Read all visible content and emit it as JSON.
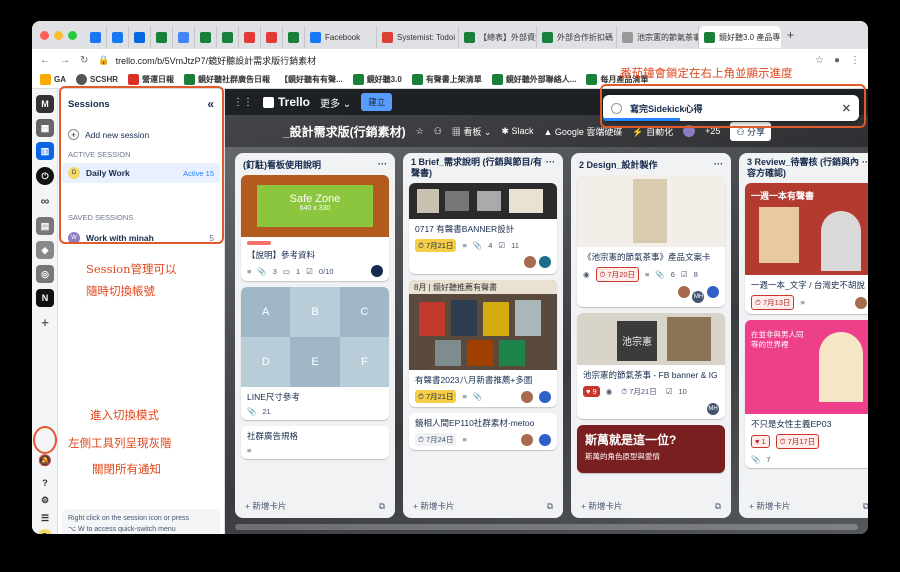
{
  "tabs": [
    "",
    "",
    "",
    "",
    "",
    "",
    "",
    "",
    "",
    "",
    "Facebook",
    "Systemist: Todoi",
    "【總表】外部資源",
    "外部合作折扣碼",
    "池宗憲的節氣茶事",
    "鏡好聽3.0 產品專"
  ],
  "address": {
    "url": "trello.com/b/5VmJtzP7/鏡好聽設計需求版行銷素材"
  },
  "bookmarks": [
    "GA",
    "SCSHR",
    "營運日報",
    "鏡好聽社群廣告日報",
    "【鏡好聽有有聲...",
    "鏡好聽3.0",
    "有聲書上架清單",
    "鏡好聽外部聯絡人...",
    "每月產品清單"
  ],
  "sessions": {
    "title": "Sessions",
    "add": "Add new session",
    "active_label": "ACTIVE SESSION",
    "active_name": "Daily Work",
    "active_badge": "Active 15",
    "saved_label": "SAVED SESSIONS",
    "saved_name": "Work with minah",
    "saved_count": "5",
    "footer_line1": "Right click on the session icon or press",
    "footer_line2": "⌥  W  to access quick-switch menu",
    "active_initial": "D",
    "saved_initial": "W"
  },
  "rail": {
    "bottom_initial": "D"
  },
  "trello": {
    "logo": "Trello",
    "more": "更多",
    "create": "建立",
    "board_title": "_設計需求版(行銷素材)",
    "view": "看板",
    "slack": "Slack",
    "google": "Google 雲端硬碟",
    "automation": "自動化",
    "members": "+25",
    "share": "分享"
  },
  "task_popup": {
    "text": "寫完Sidekick心得"
  },
  "lists": [
    {
      "title": "(釘駐)看板使用說明",
      "cards": [
        {
          "img_text": "Safe Zone",
          "img_sub": "640 x 330",
          "title": "【說明】參考資料",
          "count1": "3",
          "count2": "1",
          "check": "0/10"
        },
        {
          "grid": [
            "A",
            "B",
            "C",
            "D",
            "E",
            "F"
          ],
          "title": "LINE尺寸參考",
          "count1": "21"
        },
        {
          "title": "社群廣告規格"
        }
      ],
      "add": "新增卡片"
    },
    {
      "title": "1 Brief_需求說明 (行銷與節目/有聲書)",
      "cards": [
        {
          "title": "0717 有聲書BANNER設計",
          "date": "7月21日",
          "count1": "4",
          "count2": "11"
        },
        {
          "img_text": "8月 | 鏡好聽推薦有聲書",
          "title": "有聲書2023八月新書推薦+多圖",
          "date": "7月21日"
        },
        {
          "title": "鏡相人間EP110社群素材-metoo",
          "date": "7月24日"
        }
      ],
      "add": "新增卡片"
    },
    {
      "title": "2 Design_設計製作",
      "cards": [
        {
          "title": "《池宗憲的節氣茶事》產品文案卡",
          "date": "7月20日",
          "count1": "6",
          "count2": "8"
        },
        {
          "img_text": "池宗憲",
          "title": "池宗憲的節氣茶事 - FB banner & IG",
          "badge": "9",
          "date": "7月21日",
          "count2": "10"
        },
        {
          "img_text": "斯萬就是這一位?",
          "img_sub": "斯萬的角色原型與愛情"
        }
      ],
      "add": "新增卡片"
    },
    {
      "title": "3 Review_待審核 (行銷與內容方確認)",
      "cards": [
        {
          "img_text": "一週一本有聲書",
          "title": "一週一本_文字 / 台灣史不胡說",
          "date": "7月13日"
        },
        {
          "img_text": "在並非與男人同等的世界裡",
          "title": "不只是女性主義EP03",
          "badge": "1",
          "date": "7月17日",
          "count1": "7"
        }
      ],
      "add": "新增卡片"
    }
  ],
  "annotations": {
    "top": "番茄鐘會鎖定在右上角並顯示進度",
    "sessions_1": "Session管理可以",
    "sessions_2": "隨時切換帳號",
    "focus_1": "進入切換模式",
    "focus_2": "左側工具列呈現灰階",
    "focus_3": "關閉所有通知"
  },
  "colors": {
    "accent": "#e0471c",
    "trello_bar": "#1d2125",
    "active_session_bg": "#e9f0ff"
  }
}
